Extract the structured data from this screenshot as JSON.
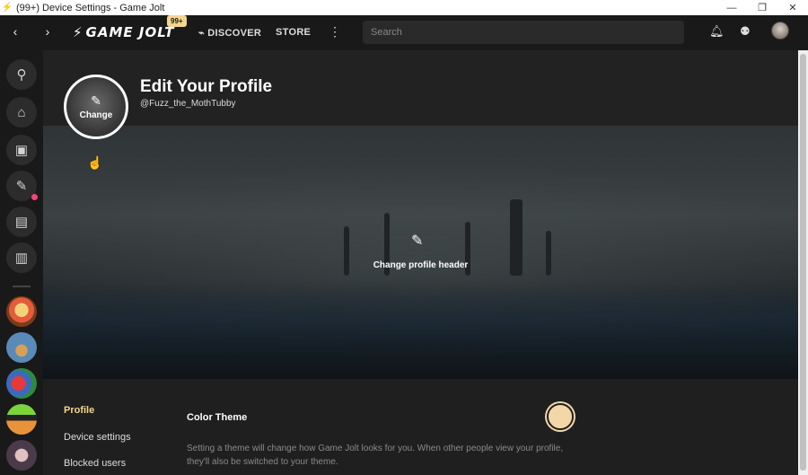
{
  "window": {
    "title": "(99+) Device Settings - Game Jolt",
    "controls": [
      "minimize",
      "restore",
      "close"
    ]
  },
  "nav": {
    "logo_text": "GAME JOLT",
    "notif_badge": "99+",
    "discover_label": "DISCOVER",
    "store_label": "STORE",
    "search_placeholder": "Search"
  },
  "sidebar": {
    "icons": [
      "lightbulb-icon",
      "store-icon",
      "backpack-icon",
      "creator-icon",
      "chat-icon",
      "library-icon"
    ],
    "notification_color": "#ff3f7a"
  },
  "profile": {
    "title": "Edit Your Profile",
    "username": "@Fuzz_the_MothTubby",
    "avatar_change_label": "Change",
    "change_header_label": "Change profile header"
  },
  "settings": {
    "menu": [
      {
        "label": "Profile",
        "active": true
      },
      {
        "label": "Device settings",
        "active": false
      },
      {
        "label": "Blocked users",
        "active": false
      }
    ],
    "color_theme_label": "Color Theme",
    "color_theme_swatch": "#f3d7a8",
    "color_theme_desc": "Setting a theme will change how Game Jolt looks for you. When other people view your profile, they'll also be switched to your theme."
  },
  "colors": {
    "accent": "#f5d58e",
    "background": "#191919"
  }
}
